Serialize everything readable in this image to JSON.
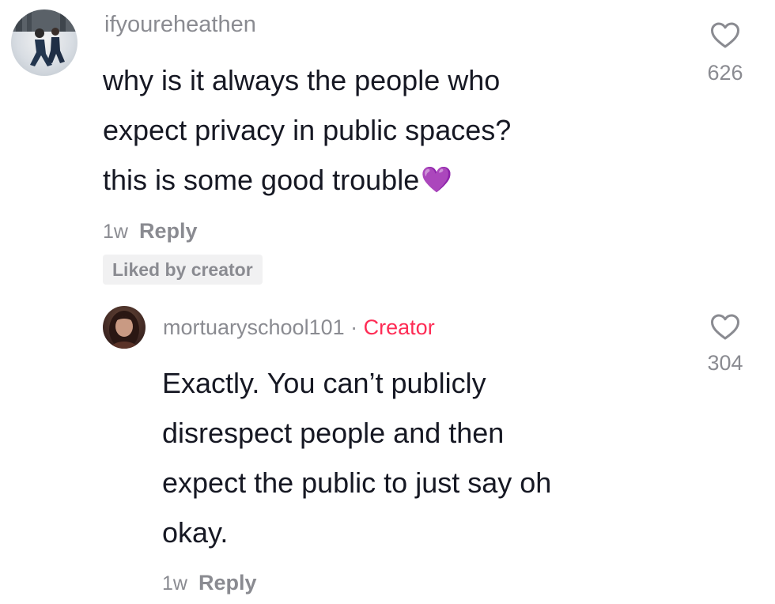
{
  "comments": [
    {
      "username": "ifyoureheathen",
      "text_lines": [
        "why is it always the people who",
        "expect privacy in public spaces?",
        "this is some good trouble"
      ],
      "emoji": "💜",
      "age": "1w",
      "reply_label": "Reply",
      "badge": "Liked by creator",
      "likes": "626",
      "avatar_icon": "user-avatar-photo",
      "like_icon": "heart-outline-icon"
    },
    {
      "username": "mortuaryschool101",
      "separator": "·",
      "creator_label": "Creator",
      "text_lines": [
        "Exactly. You can’t publicly",
        "disrespect people and then",
        "expect the public to just say oh",
        "okay."
      ],
      "age": "1w",
      "reply_label": "Reply",
      "likes": "304",
      "avatar_icon": "user-avatar-photo",
      "like_icon": "heart-outline-icon"
    }
  ],
  "colors": {
    "text": "#161823",
    "muted": "#8a8b91",
    "creator": "#fe2c55",
    "badge_bg": "#f1f1f2",
    "emoji_purple": "#9b40d8"
  }
}
